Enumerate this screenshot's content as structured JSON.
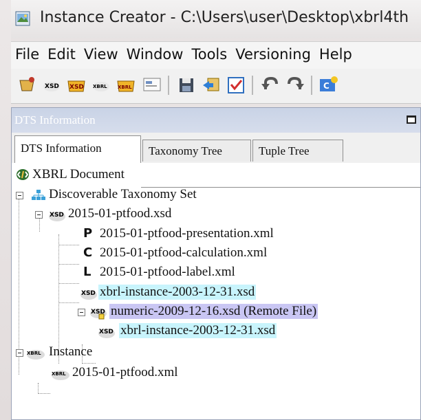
{
  "window": {
    "title": "Instance Creator - C:\\Users\\user\\Desktop\\xbrl4th"
  },
  "menu": [
    "File",
    "Edit",
    "View",
    "Window",
    "Tools",
    "Versioning",
    "Help"
  ],
  "toolbar": {
    "xsd_label": "XSD",
    "xbrl_label": "XBRL"
  },
  "panel": {
    "title": "DTS Information",
    "tabs": [
      "DTS Information",
      "Taxonomy Tree",
      "Tuple Tree"
    ],
    "active_tab": "DTS Information"
  },
  "tree": {
    "root": "XBRL Document",
    "dts": "Discoverable Taxonomy Set",
    "schema": "2015-01-ptfood.xsd",
    "presentation": "2015-01-ptfood-presentation.xml",
    "calculation": "2015-01-ptfood-calculation.xml",
    "label": "2015-01-ptfood-label.xml",
    "instance_xsd_1": "xbrl-instance-2003-12-31.xsd",
    "numeric": "numeric-2009-12-16.xsd (Remote File)",
    "instance_xsd_2": "xbrl-instance-2003-12-31.xsd",
    "instance": "Instance",
    "instance_file": "2015-01-ptfood.xml",
    "letters": {
      "presentation": "P",
      "calculation": "C",
      "label": "L"
    },
    "badges": {
      "xsd": "XSD",
      "xbrl": "XBRL"
    }
  },
  "colors": {
    "highlight_cyan": "#c8f4fc",
    "highlight_purple": "#c9c6f3",
    "panel_header": "#ccd5e8"
  }
}
